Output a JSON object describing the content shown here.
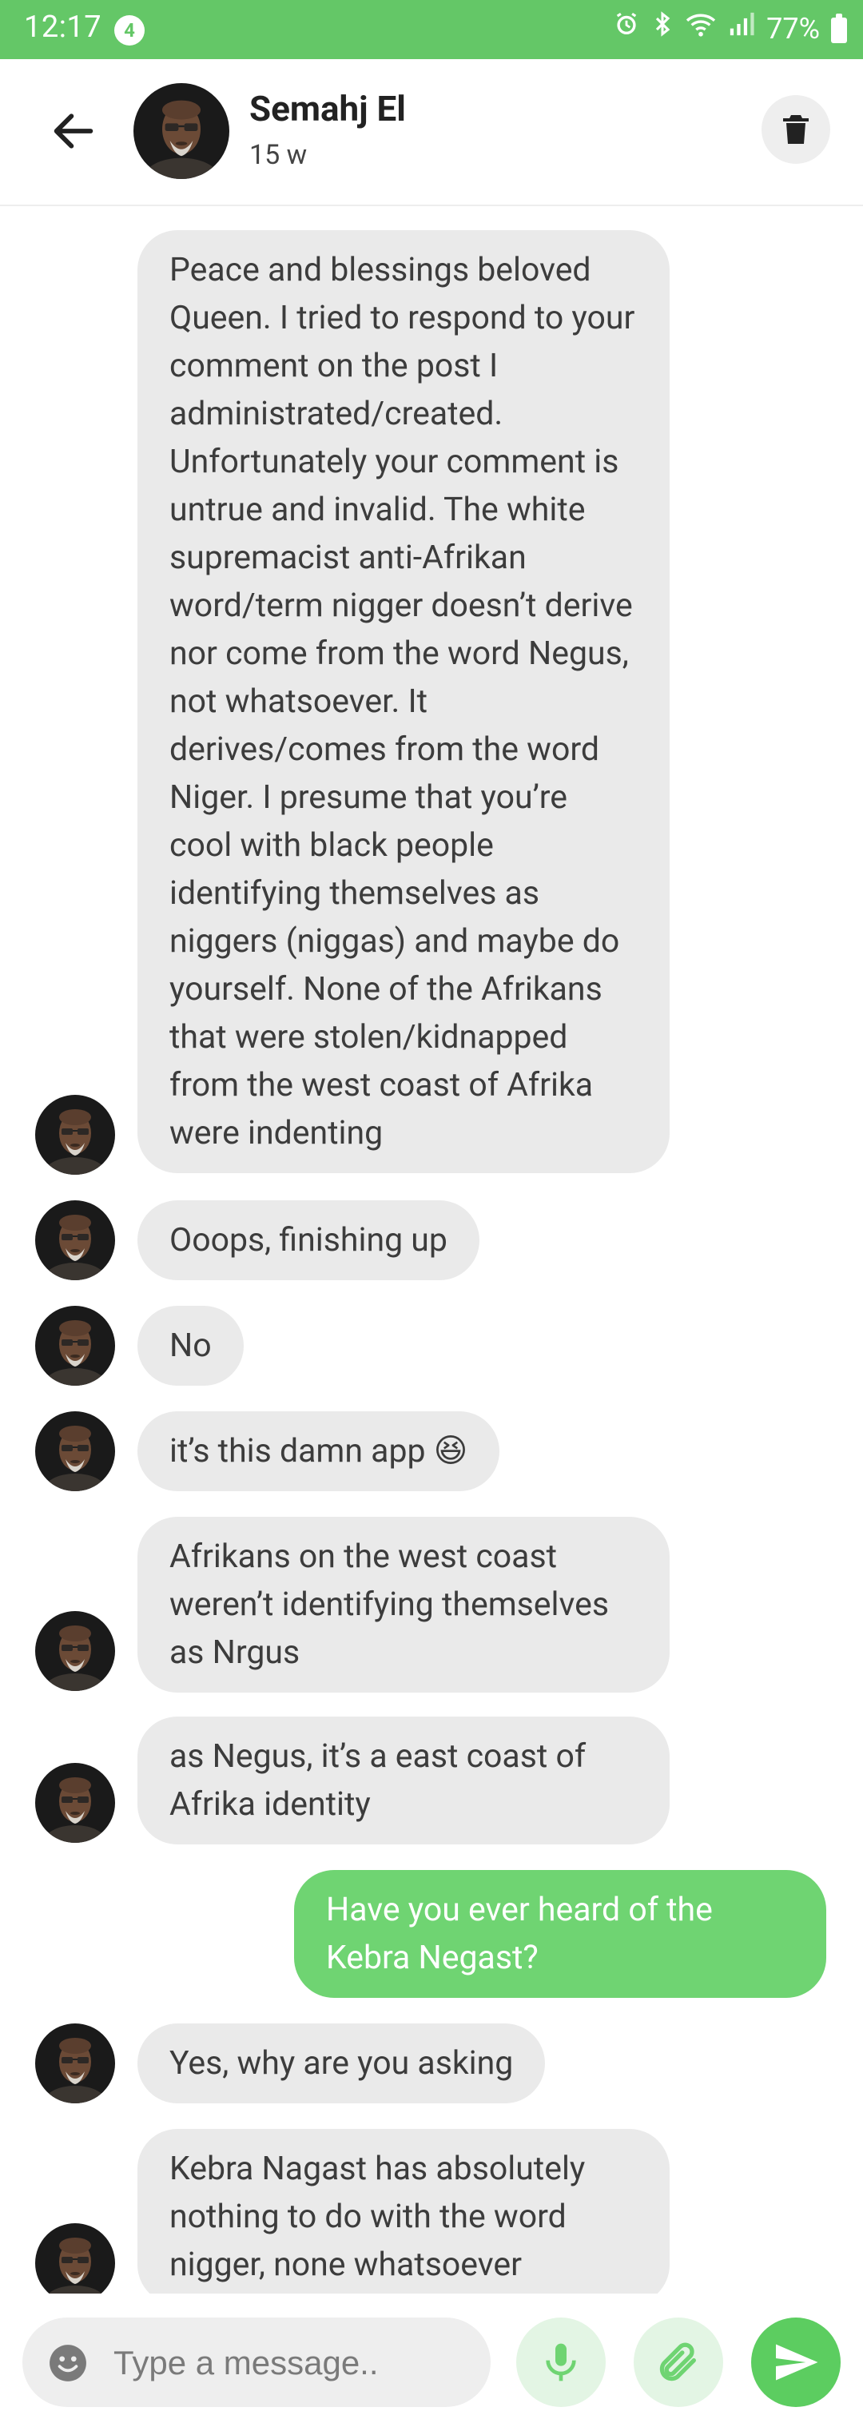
{
  "status_bar": {
    "time": "12:17",
    "notification_count": "4",
    "battery": "77%",
    "icons": [
      "alarm-icon",
      "bluetooth-icon",
      "wifi-icon",
      "signal-icon",
      "battery-icon"
    ]
  },
  "header": {
    "contact_name": "Semahj El",
    "contact_subtitle": "15 w",
    "icons": [
      "back-arrow-icon",
      "trash-icon"
    ]
  },
  "messages": [
    {
      "direction": "incoming",
      "text": "Peace and blessings beloved Queen. I tried to respond to your comment on the post I administrated/created. Unfortunately your comment is untrue and invalid. The white supremacist anti-Afrikan word/term nigger doesn’t derive nor come from the word Negus, not whatsoever. It derives/comes from the word Niger. I presume that you’re cool with black people identifying themselves as niggers (niggas) and maybe do yourself. None of the Afrikans that were stolen/kidnapped from the west coast of Afrika were indenting"
    },
    {
      "direction": "incoming",
      "text": "Ooops, finishing up"
    },
    {
      "direction": "incoming",
      "text": "No"
    },
    {
      "direction": "incoming",
      "text": "it’s this damn app 😆"
    },
    {
      "direction": "incoming",
      "text": "Afrikans on the west coast weren’t identifying themselves as Nrgus"
    },
    {
      "direction": "incoming",
      "text": "as Negus, it’s a east coast of Afrika identity"
    },
    {
      "direction": "outgoing",
      "text": "Have you ever heard of the Kebra Negast?"
    },
    {
      "direction": "incoming",
      "text": "Yes, why are you asking"
    },
    {
      "direction": "incoming",
      "text": "Kebra Nagast has absolutely nothing to do with the word nigger, none whatsoever"
    }
  ],
  "composer": {
    "placeholder": "Type a message..",
    "icons": [
      "emoji-icon",
      "microphone-icon",
      "paperclip-icon",
      "send-icon"
    ]
  },
  "colors": {
    "accent": "#64c767",
    "outgoing_bubble": "#6fd472",
    "incoming_bubble": "#eaeaea"
  }
}
